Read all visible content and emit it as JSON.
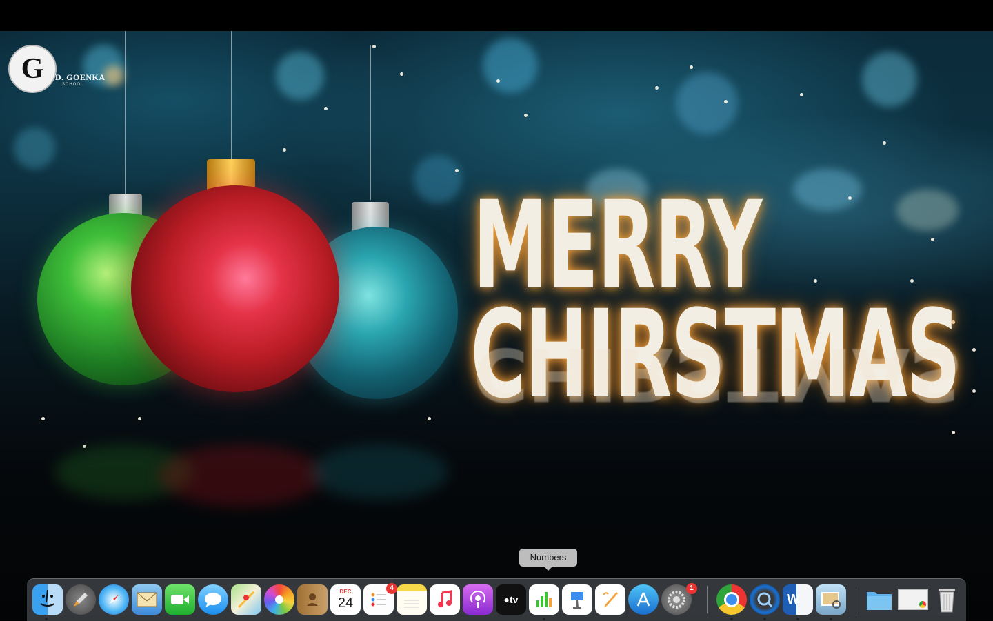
{
  "wallpaper": {
    "greeting_line1": "MERRY",
    "greeting_line2": "CHIRSTMAS",
    "logo_letter": "G",
    "logo_name": "D. GOENKA",
    "logo_sub": "SCHOOL",
    "colors": {
      "text_glow": "#ffaa3c",
      "ornament_green": "#2fa43a",
      "ornament_red": "#d42a2a",
      "ornament_teal": "#1e8a9a"
    }
  },
  "tooltip": {
    "label": "Numbers"
  },
  "dock": {
    "apps": [
      {
        "name": "finder-icon",
        "label": ""
      },
      {
        "name": "launchpad-icon",
        "label": ""
      },
      {
        "name": "safari-icon",
        "label": ""
      },
      {
        "name": "mail-icon",
        "label": ""
      },
      {
        "name": "facetime-icon",
        "label": ""
      },
      {
        "name": "messages-icon",
        "label": ""
      },
      {
        "name": "maps-icon",
        "label": ""
      },
      {
        "name": "photos-icon",
        "label": ""
      },
      {
        "name": "contacts-icon",
        "label": ""
      },
      {
        "name": "calendar-icon",
        "label": "",
        "month": "DEC",
        "day": "24"
      },
      {
        "name": "reminders-icon",
        "label": "",
        "badge": "4"
      },
      {
        "name": "notes-icon",
        "label": ""
      },
      {
        "name": "music-icon",
        "label": ""
      },
      {
        "name": "podcasts-icon",
        "label": ""
      },
      {
        "name": "apple-tv-icon",
        "label": "tv"
      },
      {
        "name": "numbers-icon",
        "label": ""
      },
      {
        "name": "keynote-icon",
        "label": ""
      },
      {
        "name": "pages-icon",
        "label": ""
      },
      {
        "name": "app-store-icon",
        "label": ""
      },
      {
        "name": "system-preferences-icon",
        "label": "",
        "badge": "1"
      },
      {
        "name": "chrome-icon",
        "label": ""
      },
      {
        "name": "quicktime-icon",
        "label": ""
      },
      {
        "name": "word-icon",
        "label": "W"
      },
      {
        "name": "preview-icon",
        "label": ""
      },
      {
        "name": "downloads-folder-icon",
        "label": ""
      },
      {
        "name": "chrome-window-icon",
        "label": ""
      },
      {
        "name": "trash-icon",
        "label": ""
      }
    ]
  }
}
